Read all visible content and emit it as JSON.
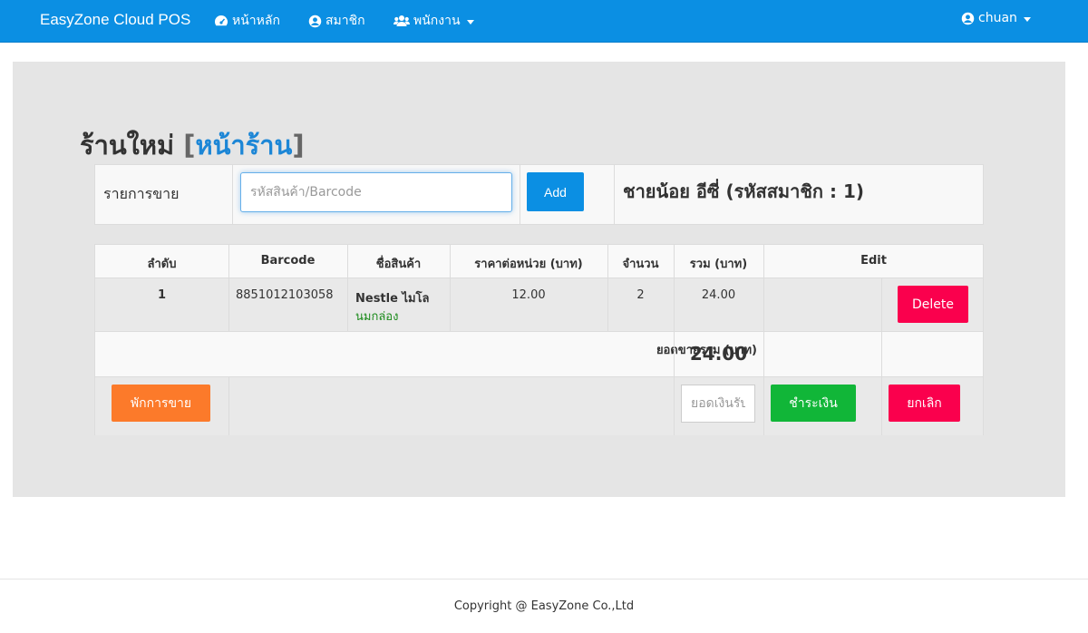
{
  "navbar": {
    "brand": "EasyZone Cloud POS",
    "items": [
      {
        "label": "หน้าหลัก",
        "icon": "dashboard-icon"
      },
      {
        "label": "สมาชิก",
        "icon": "user-circle-icon"
      },
      {
        "label": "พนักงาน",
        "icon": "users-icon"
      }
    ],
    "user": {
      "label": "chuan",
      "icon": "user-circle-icon"
    }
  },
  "page": {
    "title_prefix": "ร้านใหม่",
    "title_open": "[",
    "title_link": "หน้าร้าน",
    "title_close": "]"
  },
  "sale_form": {
    "label": "รายการขาย",
    "barcode_placeholder": "รหัสสินค้า/Barcode",
    "add_label": "Add",
    "member": "ชายน้อย อีซี่ (รหัสสมาชิก : 1)"
  },
  "table": {
    "headers": [
      "ลำดับ",
      "Barcode",
      "ชื่อสินค้า",
      "ราคาต่อหน่วย (บาท)",
      "จำนวน",
      "รวม (บาท)",
      "Edit"
    ],
    "rows": [
      {
        "index": "1",
        "barcode": "8851012103058",
        "name_line1": "Nestle ไมโล",
        "name_line2": "นมกล่อง",
        "unit_price": "12.00",
        "qty": "2",
        "total": "24.00",
        "delete_label": "Delete"
      }
    ],
    "grand_total_label": "ยอดขายรวม (บาท)",
    "grand_total": "24.00"
  },
  "actions": {
    "hold_label": "พักการขาย",
    "cash_placeholder": "ยอดเงินรับ",
    "pay_label": "ชำระเงิน",
    "cancel_label": "ยกเลิก"
  },
  "colors": {
    "navbar": "#0b8fe3",
    "link": "#1c86d6",
    "delete": "#fa004d",
    "hold": "#fc7a2a",
    "pay": "#11b638",
    "product_subtitle": "#1a8a1a"
  },
  "footer": {
    "text": "Copyright @ EasyZone Co.,Ltd"
  }
}
